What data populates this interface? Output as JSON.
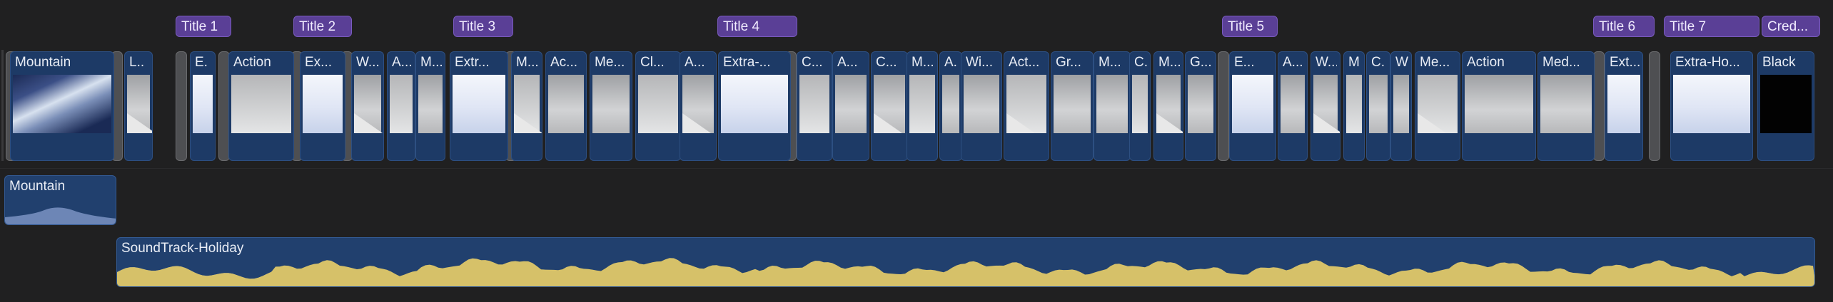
{
  "titles": [
    {
      "label": "Title 1"
    },
    {
      "label": "Title 2"
    },
    {
      "label": "Title 3"
    },
    {
      "label": "Title 4"
    },
    {
      "label": "Title 5"
    },
    {
      "label": "Title 6"
    },
    {
      "label": "Title 7"
    },
    {
      "label": "Cred..."
    }
  ],
  "clips": [
    {
      "label": "Mountain",
      "kind": "photo"
    },
    {
      "label": "L..",
      "kind": "grey"
    },
    {
      "label": "E.",
      "kind": "bright"
    },
    {
      "label": "Action",
      "kind": "grey"
    },
    {
      "label": "Ex...",
      "kind": "bright"
    },
    {
      "label": "W...",
      "kind": "grey"
    },
    {
      "label": "A...",
      "kind": "grey"
    },
    {
      "label": "M...",
      "kind": "grey"
    },
    {
      "label": "Extr...",
      "kind": "bright"
    },
    {
      "label": "M...",
      "kind": "grey"
    },
    {
      "label": "Ac...",
      "kind": "grey"
    },
    {
      "label": "Me...",
      "kind": "grey"
    },
    {
      "label": "Cl...",
      "kind": "grey"
    },
    {
      "label": "A...",
      "kind": "grey"
    },
    {
      "label": "Extra-...",
      "kind": "bright"
    },
    {
      "label": "C...",
      "kind": "grey"
    },
    {
      "label": "A...",
      "kind": "grey"
    },
    {
      "label": "C...",
      "kind": "grey"
    },
    {
      "label": "M...",
      "kind": "grey"
    },
    {
      "label": "A.",
      "kind": "grey"
    },
    {
      "label": "Wi...",
      "kind": "grey"
    },
    {
      "label": "Act...",
      "kind": "grey"
    },
    {
      "label": "Gr...",
      "kind": "grey"
    },
    {
      "label": "M...",
      "kind": "grey"
    },
    {
      "label": "C.",
      "kind": "grey"
    },
    {
      "label": "M...",
      "kind": "grey"
    },
    {
      "label": "G...",
      "kind": "grey"
    },
    {
      "label": "E...",
      "kind": "bright"
    },
    {
      "label": "A...",
      "kind": "grey"
    },
    {
      "label": "W...",
      "kind": "grey"
    },
    {
      "label": "M",
      "kind": "grey"
    },
    {
      "label": "C.",
      "kind": "grey"
    },
    {
      "label": "W",
      "kind": "grey"
    },
    {
      "label": "Me...",
      "kind": "grey"
    },
    {
      "label": "Action",
      "kind": "grey"
    },
    {
      "label": "Med...",
      "kind": "grey"
    },
    {
      "label": "Ext...",
      "kind": "bright"
    },
    {
      "label": "Extra-Ho...",
      "kind": "bright"
    },
    {
      "label": "Black",
      "kind": "dark"
    }
  ],
  "audio": [
    {
      "label": "Mountain"
    },
    {
      "label": "SoundTrack-Holiday"
    }
  ]
}
